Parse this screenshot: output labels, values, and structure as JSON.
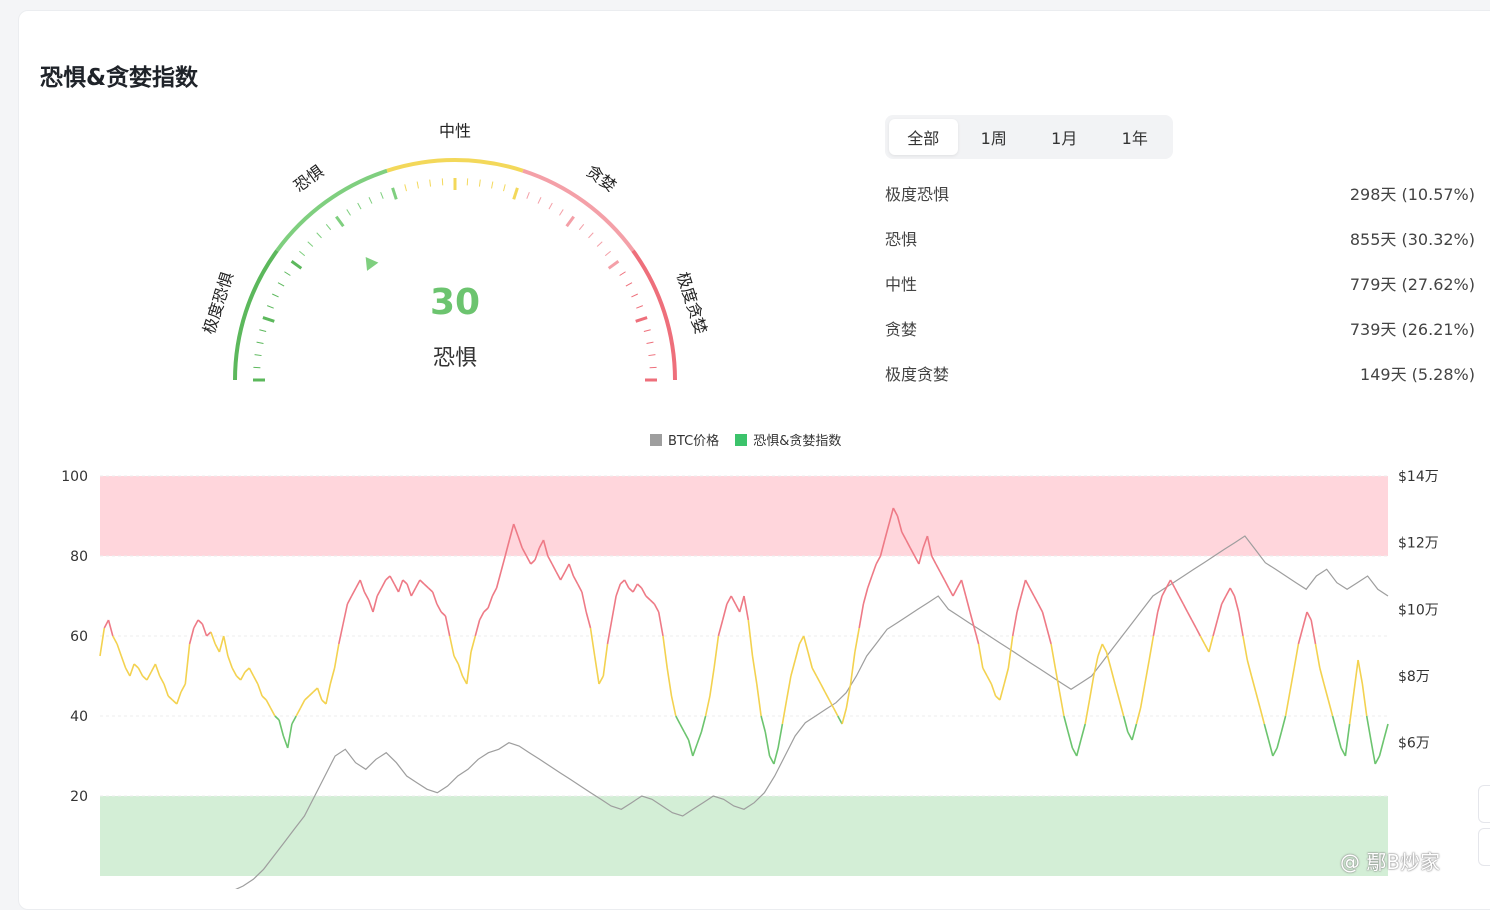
{
  "page": {
    "title": "恐惧&贪婪指数"
  },
  "gauge": {
    "value": 30,
    "value_text": "30",
    "status": "恐惧",
    "zones": [
      {
        "label": "极度恐惧",
        "from": 0,
        "to": 20,
        "color": "#5cb85c"
      },
      {
        "label": "恐惧",
        "from": 20,
        "to": 40,
        "color": "#7fcf7f"
      },
      {
        "label": "中性",
        "from": 40,
        "to": 60,
        "color": "#f3d85a"
      },
      {
        "label": "贪婪",
        "from": 60,
        "to": 80,
        "color": "#f4a0a8"
      },
      {
        "label": "极度贪婪",
        "from": 80,
        "to": 100,
        "color": "#ee6f7b"
      }
    ]
  },
  "tabs": [
    {
      "label": "全部",
      "active": true
    },
    {
      "label": "1周",
      "active": false
    },
    {
      "label": "1月",
      "active": false
    },
    {
      "label": "1年",
      "active": false
    }
  ],
  "stats": [
    {
      "label": "极度恐惧",
      "value": "298天 (10.57%)"
    },
    {
      "label": "恐惧",
      "value": "855天 (30.32%)"
    },
    {
      "label": "中性",
      "value": "779天 (27.62%)"
    },
    {
      "label": "贪婪",
      "value": "739天 (26.21%)"
    },
    {
      "label": "极度贪婪",
      "value": "149天 (5.28%)"
    }
  ],
  "legend": [
    {
      "label": "BTC价格",
      "color": "#9e9e9e"
    },
    {
      "label": "恐惧&贪婪指数",
      "color": "#3cc36b"
    }
  ],
  "chart_data": {
    "type": "line",
    "y_left": {
      "ticks": [
        "100",
        "80",
        "60",
        "40",
        "20"
      ],
      "range": [
        0,
        100
      ]
    },
    "y_right": {
      "ticks": [
        "$14万",
        "$12万",
        "$10万",
        "$8万",
        "$6万"
      ],
      "range": [
        20000,
        140000
      ]
    },
    "bands": [
      {
        "from": 80,
        "to": 100,
        "color": "#ffd6dc"
      },
      {
        "from": 0,
        "to": 20,
        "color": "#d3eed6"
      }
    ],
    "thresholds": {
      "fear": 40,
      "neutral": 60,
      "greed": 80
    },
    "colors": {
      "greed": "#ee7a86",
      "neutral": "#f3d250",
      "fear": "#6cc46f",
      "price": "#9e9e9e"
    },
    "series": [
      {
        "name": "恐惧&贪婪指数",
        "values": [
          55,
          62,
          64,
          60,
          58,
          55,
          52,
          50,
          53,
          52,
          50,
          49,
          51,
          53,
          50,
          48,
          45,
          44,
          43,
          46,
          48,
          58,
          62,
          64,
          63,
          60,
          61,
          58,
          56,
          60,
          55,
          52,
          50,
          49,
          51,
          52,
          50,
          48,
          45,
          44,
          42,
          40,
          39,
          35,
          32,
          38,
          40,
          42,
          44,
          45,
          46,
          47,
          44,
          43,
          48,
          52,
          58,
          63,
          68,
          70,
          72,
          74,
          71,
          69,
          66,
          70,
          72,
          74,
          75,
          73,
          71,
          74,
          73,
          70,
          72,
          74,
          73,
          72,
          71,
          68,
          66,
          65,
          60,
          55,
          53,
          50,
          48,
          56,
          60,
          64,
          66,
          67,
          70,
          72,
          76,
          80,
          84,
          88,
          85,
          82,
          80,
          78,
          79,
          82,
          84,
          80,
          78,
          76,
          74,
          76,
          78,
          75,
          73,
          71,
          66,
          62,
          55,
          48,
          50,
          58,
          64,
          70,
          73,
          74,
          72,
          71,
          73,
          72,
          70,
          69,
          68,
          66,
          60,
          52,
          45,
          40,
          38,
          36,
          34,
          30,
          33,
          36,
          40,
          45,
          52,
          60,
          64,
          68,
          70,
          68,
          66,
          70,
          64,
          55,
          48,
          40,
          36,
          30,
          28,
          32,
          38,
          44,
          50,
          54,
          58,
          60,
          56,
          52,
          50,
          48,
          46,
          44,
          42,
          40,
          38,
          42,
          48,
          56,
          62,
          68,
          72,
          75,
          78,
          80,
          84,
          88,
          92,
          90,
          86,
          84,
          82,
          80,
          78,
          82,
          85,
          80,
          78,
          76,
          74,
          72,
          70,
          72,
          74,
          70,
          66,
          62,
          58,
          52,
          50,
          48,
          45,
          44,
          48,
          52,
          60,
          66,
          70,
          74,
          72,
          70,
          68,
          66,
          62,
          58,
          52,
          46,
          40,
          36,
          32,
          30,
          34,
          38,
          44,
          50,
          55,
          58,
          56,
          52,
          48,
          44,
          40,
          36,
          34,
          38,
          42,
          48,
          54,
          60,
          66,
          70,
          72,
          74,
          72,
          70,
          68,
          66,
          64,
          62,
          60,
          58,
          56,
          60,
          64,
          68,
          70,
          72,
          70,
          66,
          60,
          54,
          50,
          46,
          42,
          38,
          34,
          30,
          32,
          36,
          40,
          46,
          52,
          58,
          62,
          66,
          64,
          58,
          52,
          48,
          44,
          40,
          36,
          32,
          30,
          38,
          46,
          54,
          48,
          40,
          34,
          28,
          30,
          34,
          38
        ],
        "color": "#f3d250"
      },
      {
        "name": "BTC价格",
        "values": [
          9000,
          9200,
          9100,
          9300,
          9500,
          9800,
          10200,
          10600,
          11000,
          11800,
          12500,
          13200,
          14200,
          15600,
          17000,
          19000,
          22000,
          26000,
          30000,
          34000,
          38000,
          44000,
          50000,
          56000,
          58000,
          54000,
          52000,
          55000,
          57000,
          54000,
          50000,
          48000,
          46000,
          45000,
          47000,
          50000,
          52000,
          55000,
          57000,
          58000,
          60000,
          59000,
          57000,
          55000,
          53000,
          51000,
          49000,
          47000,
          45000,
          43000,
          41000,
          40000,
          42000,
          44000,
          43000,
          41000,
          39000,
          38000,
          40000,
          42000,
          44000,
          43000,
          41000,
          40000,
          42000,
          45000,
          50000,
          56000,
          62000,
          66000,
          68000,
          70000,
          72000,
          75000,
          80000,
          86000,
          90000,
          94000,
          96000,
          98000,
          100000,
          102000,
          104000,
          100000,
          98000,
          96000,
          94000,
          92000,
          90000,
          88000,
          86000,
          84000,
          82000,
          80000,
          78000,
          76000,
          78000,
          80000,
          84000,
          88000,
          92000,
          96000,
          100000,
          104000,
          106000,
          108000,
          110000,
          112000,
          114000,
          116000,
          118000,
          120000,
          122000,
          118000,
          114000,
          112000,
          110000,
          108000,
          106000,
          110000,
          112000,
          108000,
          106000,
          108000,
          110000,
          106000,
          104000
        ],
        "color": "#9e9e9e"
      }
    ]
  },
  "watermark": {
    "text": "@ 鄢B炒家"
  }
}
